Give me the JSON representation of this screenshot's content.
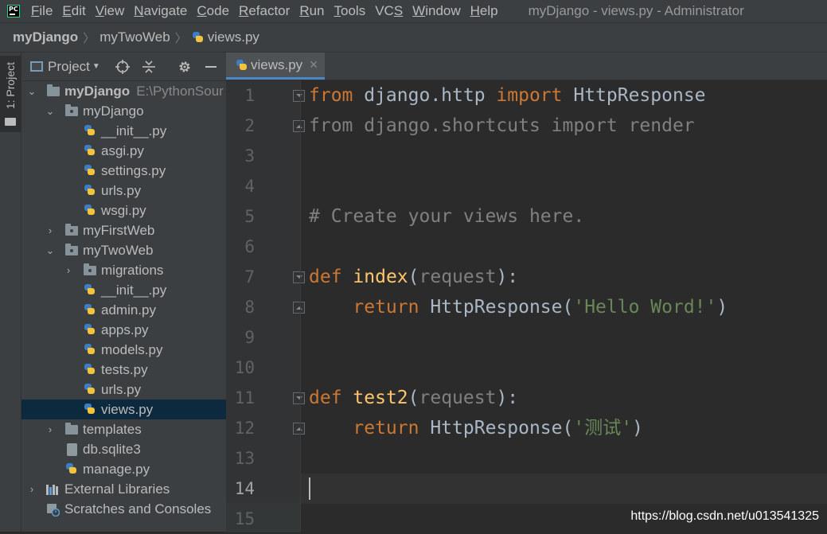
{
  "menu": {
    "items": [
      {
        "label": "File",
        "mnemonic": "F",
        "rest": "ile"
      },
      {
        "label": "Edit",
        "mnemonic": "E",
        "rest": "dit"
      },
      {
        "label": "View",
        "mnemonic": "V",
        "rest": "iew"
      },
      {
        "label": "Navigate",
        "mnemonic": "N",
        "rest": "avigate"
      },
      {
        "label": "Code",
        "mnemonic": "C",
        "rest": "ode"
      },
      {
        "label": "Refactor",
        "mnemonic": "R",
        "rest": "efactor"
      },
      {
        "label": "Run",
        "mnemonic": "R",
        "rest": "un"
      },
      {
        "label": "Tools",
        "mnemonic": "T",
        "rest": "ools"
      },
      {
        "label": "VCS",
        "mnemonic": "S",
        "rest": "VC"
      },
      {
        "label": "Window",
        "mnemonic": "W",
        "rest": "indow"
      },
      {
        "label": "Help",
        "mnemonic": "H",
        "rest": "elp"
      }
    ],
    "window_title": "myDjango - views.py - Administrator",
    "logo_text": "PC"
  },
  "breadcrumb": {
    "items": [
      "myDjango",
      "myTwoWeb",
      "views.py"
    ]
  },
  "toolstrip": {
    "project_tab_label": "1: Project"
  },
  "project_panel": {
    "title": "Project",
    "tree": [
      {
        "label": "myDjango",
        "path": "E:\\PythonSour",
        "kind": "root",
        "expanded": true
      },
      {
        "label": "myDjango",
        "kind": "folder",
        "expanded": true
      },
      {
        "label": "__init__.py",
        "kind": "py"
      },
      {
        "label": "asgi.py",
        "kind": "py"
      },
      {
        "label": "settings.py",
        "kind": "py"
      },
      {
        "label": "urls.py",
        "kind": "py"
      },
      {
        "label": "wsgi.py",
        "kind": "py"
      },
      {
        "label": "myFirstWeb",
        "kind": "folder",
        "expanded": false
      },
      {
        "label": "myTwoWeb",
        "kind": "folder",
        "expanded": true
      },
      {
        "label": "migrations",
        "kind": "folder",
        "expanded": false
      },
      {
        "label": "__init__.py",
        "kind": "py"
      },
      {
        "label": "admin.py",
        "kind": "py"
      },
      {
        "label": "apps.py",
        "kind": "py"
      },
      {
        "label": "models.py",
        "kind": "py"
      },
      {
        "label": "tests.py",
        "kind": "py"
      },
      {
        "label": "urls.py",
        "kind": "py"
      },
      {
        "label": "views.py",
        "kind": "py",
        "selected": true
      },
      {
        "label": "templates",
        "kind": "folder",
        "expanded": false
      },
      {
        "label": "db.sqlite3",
        "kind": "db"
      },
      {
        "label": "manage.py",
        "kind": "py"
      },
      {
        "label": "External Libraries",
        "kind": "libs",
        "expanded": false
      },
      {
        "label": "Scratches and Consoles",
        "kind": "scratch"
      }
    ]
  },
  "editor": {
    "tab_label": "views.py",
    "current_line": 14,
    "line_numbers": [
      "1",
      "2",
      "3",
      "4",
      "5",
      "6",
      "7",
      "8",
      "9",
      "10",
      "11",
      "12",
      "13",
      "14",
      "15"
    ],
    "code": {
      "l1": {
        "k1": "from",
        "t1": " django.http ",
        "k2": "import",
        "t2": " HttpResponse"
      },
      "l2": {
        "text": "from django.shortcuts import render"
      },
      "l5": {
        "text": "# Create your views here."
      },
      "l7": {
        "kw": "def",
        "name": "index",
        "open": "(",
        "param": "request",
        "close": "):"
      },
      "l8": {
        "kw": "return",
        "call": " HttpResponse(",
        "str": "'Hello Word!'",
        "end": ")"
      },
      "l11": {
        "kw": "def",
        "name": "test2",
        "open": "(",
        "param": "request",
        "close": "):"
      },
      "l12": {
        "kw": "return",
        "call": " HttpResponse(",
        "str": "'测试'",
        "end": ")"
      }
    }
  },
  "watermark": "https://blog.csdn.net/u013541325",
  "colors": {
    "keyword": "#cc7832",
    "function": "#ffc66d",
    "string": "#6a8759",
    "comment": "#808080",
    "selection": "#0d293e",
    "tab_underline": "#4a88c7"
  }
}
